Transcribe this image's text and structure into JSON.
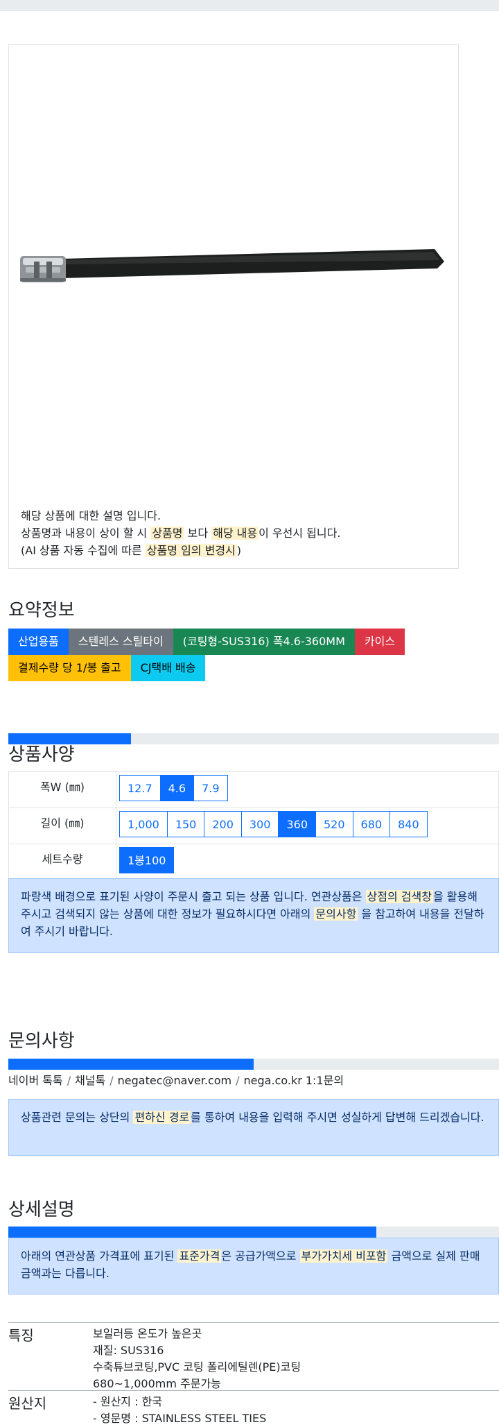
{
  "product": {
    "image_icon": "cable-tie-image",
    "desc": {
      "line1": "해당 상품에 대한 설명 입니다.",
      "line2_pre": "상품명과 내용이 상이 할 시 ",
      "line2_hl1": "상품명",
      "line2_mid": " 보다 ",
      "line2_hl2": "해당 내용",
      "line2_post": "이 우선시 됩니다.",
      "line3_pre": "(AI 상품 자동 수집에 따른 ",
      "line3_hl": "상품명 임의 변경시",
      "line3_post": ")"
    }
  },
  "summary": {
    "title": "요약정보",
    "badges": [
      "산업용품",
      "스텐레스 스틸타이",
      "(코팅형-SUS316) 폭4.6-360MM",
      "카이스",
      "결제수량 당 1/봉 출고",
      "CJ택배 배송"
    ]
  },
  "spec": {
    "title": "상품사양",
    "progress": 0.25,
    "rows": [
      {
        "label": "폭W (㎜)",
        "options": [
          "12.7",
          "4.6",
          "7.9"
        ],
        "selected": "4.6"
      },
      {
        "label": "길이 (㎜)",
        "options": [
          "1,000",
          "150",
          "200",
          "300",
          "360",
          "520",
          "680",
          "840"
        ],
        "selected": "360"
      },
      {
        "label": "세트수량",
        "options": [
          "1봉100"
        ],
        "selected": "1봉100"
      }
    ],
    "notice": {
      "pre": "파랑색 배경으로 표기된 사양이 주문시 출고 되는 상품 입니다. 연관상품은 ",
      "hl1": "상점의 검색창",
      "mid1": "을 활용해 주시고 검색되지 않는 상품에 대한 정보가 필요하시다면 아래의 ",
      "hl2": "문의사항",
      "post": " 을 참고하여 내용을 전달하여 주시기 바랍니다."
    }
  },
  "inquiry": {
    "title": "문의사항",
    "progress": 0.5,
    "contacts": [
      "네이버 톡톡",
      "채널톡",
      "negatec@naver.com",
      "nega.co.kr 1:1문의"
    ],
    "separator": "/",
    "notice": {
      "pre": "상품관련 문의는 상단의 ",
      "hl": "편하신 경로",
      "post": "를 통하여 내용을 입력해 주시면 성실하게 답변해 드리겠습니다."
    }
  },
  "detail": {
    "title": "상세설명",
    "progress": 0.75,
    "notice": {
      "pre": "아래의 연관상품 가격표에 표기된 ",
      "hl1": "표준가격",
      "mid": "은 공급가액으로 ",
      "hl2": "부가가치세 비포함",
      "post": " 금액으로 실제 판매금액과는 다릅니다."
    },
    "features": {
      "label": "특징",
      "lines": [
        "보일러등 온도가 높은곳",
        "재질: SUS316",
        "수축튜브코팅,PVC 코팅 폴리에틸렌(PE)코팅",
        "680~1,000mm 주문가능"
      ]
    },
    "origin": {
      "label": "원산지",
      "lines": [
        "- 원산지 : 한국",
        "- 영문명 : STAINLESS STEEL TIES"
      ]
    }
  },
  "colors": {
    "primary": "#0d6efd",
    "secondary": "#6c757d",
    "success": "#198754",
    "danger": "#dc3545",
    "warning": "#ffc107",
    "info": "#0dcaf0",
    "alert_bg": "#cfe2ff",
    "highlight": "#fff3cd"
  }
}
